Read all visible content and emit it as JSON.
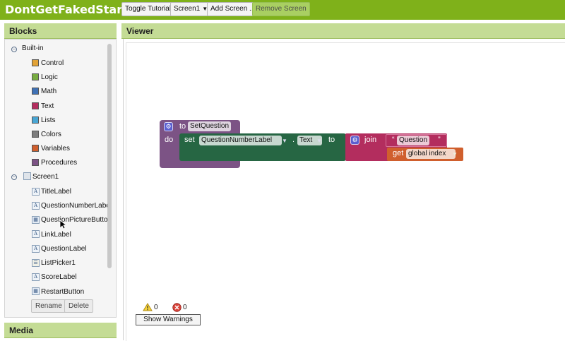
{
  "app": {
    "title": "DontGetFakedStarter"
  },
  "toolbar": {
    "toggle_tutorial": "Toggle Tutorial",
    "screen_select": "Screen1",
    "add_screen": "Add Screen ...",
    "remove_screen": "Remove Screen"
  },
  "blocks_panel": {
    "title": "Blocks",
    "builtin": {
      "label": "Built-in",
      "items": [
        {
          "label": "Control",
          "color": "#e1a236"
        },
        {
          "label": "Logic",
          "color": "#77ab41"
        },
        {
          "label": "Math",
          "color": "#3f71b5"
        },
        {
          "label": "Text",
          "color": "#b32d5e"
        },
        {
          "label": "Lists",
          "color": "#49a6d4"
        },
        {
          "label": "Colors",
          "color": "#7d7d7d"
        },
        {
          "label": "Variables",
          "color": "#d05f2d"
        },
        {
          "label": "Procedures",
          "color": "#7c5385"
        }
      ]
    },
    "screen": {
      "label": "Screen1",
      "components": [
        {
          "label": "TitleLabel",
          "icon": "label-icon"
        },
        {
          "label": "QuestionNumberLabel",
          "icon": "label-icon"
        },
        {
          "label": "QuestionPictureButton",
          "icon": "button-icon"
        },
        {
          "label": "LinkLabel",
          "icon": "label-icon"
        },
        {
          "label": "QuestionLabel",
          "icon": "label-icon"
        },
        {
          "label": "ListPicker1",
          "icon": "listpicker-icon"
        },
        {
          "label": "ScoreLabel",
          "icon": "label-icon"
        },
        {
          "label": "RestartButton",
          "icon": "button-icon"
        }
      ]
    },
    "rename": "Rename",
    "delete": "Delete"
  },
  "media_panel": {
    "title": "Media"
  },
  "viewer": {
    "title": "Viewer",
    "procedure": {
      "to": "to",
      "name": "SetQuestion",
      "do": "do",
      "set": "set",
      "component": "QuestionNumberLabel",
      "dot": ".",
      "property": "Text",
      "to2": "to",
      "join": "join",
      "open_quote": "“",
      "string_value": "Question",
      "close_quote": "”",
      "get": "get",
      "variable": "global index"
    },
    "warnings": {
      "warning_count": "0",
      "error_count": "0",
      "show_warnings": "Show Warnings"
    }
  }
}
